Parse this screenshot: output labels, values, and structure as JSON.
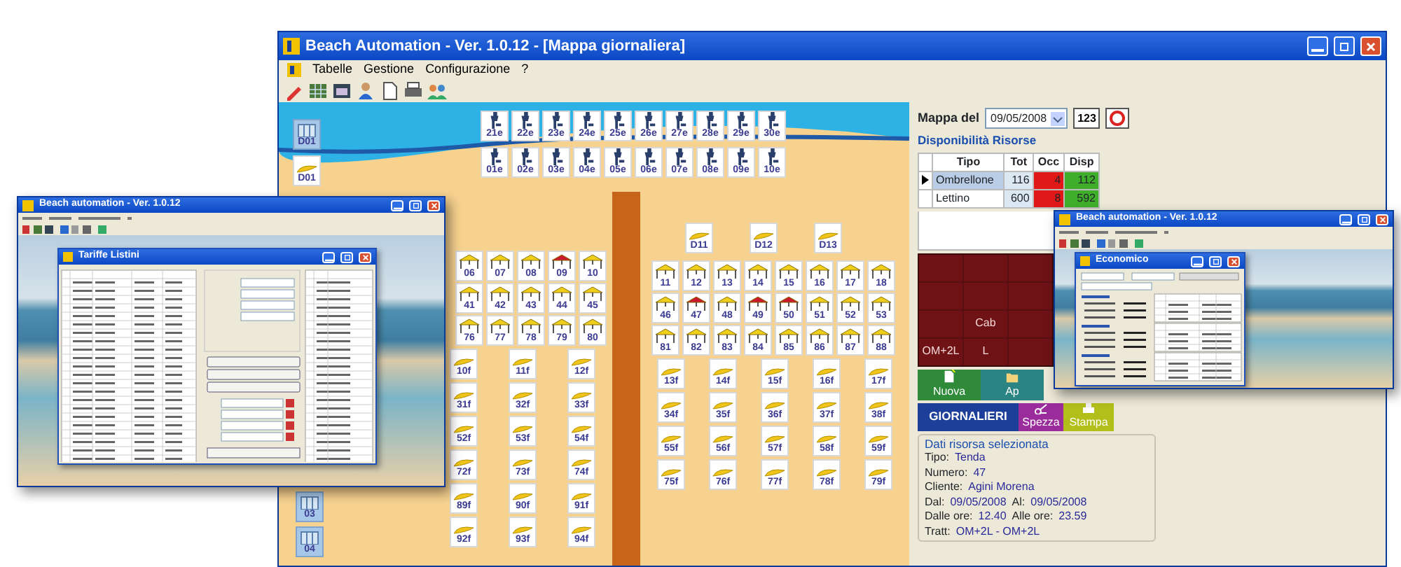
{
  "main_window": {
    "title": "Beach Automation - Ver. 1.0.12 - [Mappa giornaliera]",
    "menu": [
      "Tabelle",
      "Gestione",
      "Configurazione",
      "?"
    ]
  },
  "map": {
    "sea_cabin": "D01",
    "chair_rows": [
      [
        "21e",
        "22e",
        "23e",
        "24e",
        "25e",
        "26e",
        "27e",
        "28e",
        "29e",
        "30e"
      ],
      [
        "01e",
        "02e",
        "03e",
        "04e",
        "05e",
        "06e",
        "07e",
        "08e",
        "09e",
        "10e"
      ]
    ],
    "side_items": [
      {
        "label": "D01",
        "kind": "umbrella"
      },
      {
        "label": "03",
        "kind": "cabin"
      },
      {
        "label": "04",
        "kind": "cabin"
      }
    ],
    "left_tent_rows": [
      [
        {
          "label": "06",
          "occupied": false
        },
        {
          "label": "07",
          "occupied": false
        },
        {
          "label": "08",
          "occupied": false
        },
        {
          "label": "09",
          "occupied": true
        },
        {
          "label": "10",
          "occupied": false
        }
      ],
      [
        {
          "label": "41",
          "occupied": false
        },
        {
          "label": "42",
          "occupied": false
        },
        {
          "label": "43",
          "occupied": false
        },
        {
          "label": "44",
          "occupied": false
        },
        {
          "label": "45",
          "occupied": false
        }
      ],
      [
        {
          "label": "76",
          "occupied": false
        },
        {
          "label": "77",
          "occupied": false
        },
        {
          "label": "78",
          "occupied": false
        },
        {
          "label": "79",
          "occupied": false
        },
        {
          "label": "80",
          "occupied": false
        }
      ]
    ],
    "left_umbrella_rows": [
      [
        "10f",
        "11f",
        "12f"
      ],
      [
        "31f",
        "32f",
        "33f"
      ],
      [
        "52f",
        "53f",
        "54f"
      ],
      [
        "72f",
        "73f",
        "74f"
      ],
      [
        "89f",
        "90f",
        "91f"
      ],
      [
        "92f",
        "93f",
        "94f"
      ]
    ],
    "right_cabana_row": [
      "D11",
      "D12",
      "D13"
    ],
    "right_tent_rows": [
      [
        {
          "label": "11",
          "occupied": false
        },
        {
          "label": "12",
          "occupied": false
        },
        {
          "label": "13",
          "occupied": false
        },
        {
          "label": "14",
          "occupied": false
        },
        {
          "label": "15",
          "occupied": false
        },
        {
          "label": "16",
          "occupied": false
        },
        {
          "label": "17",
          "occupied": false
        },
        {
          "label": "18",
          "occupied": false
        }
      ],
      [
        {
          "label": "46",
          "occupied": false
        },
        {
          "label": "47",
          "occupied": true
        },
        {
          "label": "48",
          "occupied": false
        },
        {
          "label": "49",
          "occupied": true
        },
        {
          "label": "50",
          "occupied": true
        },
        {
          "label": "51",
          "occupied": false
        },
        {
          "label": "52",
          "occupied": false
        },
        {
          "label": "53",
          "occupied": false
        }
      ],
      [
        {
          "label": "81",
          "occupied": false
        },
        {
          "label": "82",
          "occupied": false
        },
        {
          "label": "83",
          "occupied": false
        },
        {
          "label": "84",
          "occupied": false
        },
        {
          "label": "85",
          "occupied": false
        },
        {
          "label": "86",
          "occupied": false
        },
        {
          "label": "87",
          "occupied": false
        },
        {
          "label": "88",
          "occupied": false
        }
      ]
    ],
    "right_umbrella_rows": [
      [
        "13f",
        "14f",
        "15f",
        "16f",
        "17f"
      ],
      [
        "34f",
        "35f",
        "36f",
        "37f",
        "38f"
      ],
      [
        "55f",
        "56f",
        "57f",
        "58f",
        "59f"
      ],
      [
        "75f",
        "76f",
        "77f",
        "78f",
        "79f"
      ]
    ]
  },
  "date_filter": {
    "label": "Mappa del",
    "value": "09/05/2008",
    "button": "123"
  },
  "availability": {
    "title": "Disponibilità Risorse",
    "columns": [
      "Tipo",
      "Tot",
      "Occ",
      "Disp"
    ],
    "rows": [
      {
        "cells": [
          "Ombrellone",
          "116",
          "4",
          "112"
        ],
        "selected": true
      },
      {
        "cells": [
          "Lettino",
          "600",
          "8",
          "592"
        ],
        "selected": false
      }
    ]
  },
  "resource_buttons": [
    {
      "kind": "blank"
    },
    {
      "kind": "blank"
    },
    {
      "kind": "blank"
    },
    {
      "kind": "blank"
    },
    {
      "kind": "blank"
    },
    {
      "kind": "blank"
    },
    {
      "kind": "blank"
    },
    {
      "kind": "labeled",
      "label": "Cab"
    },
    {
      "kind": "blank"
    },
    {
      "kind": "labeled",
      "label": "OM+2L"
    },
    {
      "kind": "labeled",
      "label": "L"
    },
    {
      "kind": "blank"
    }
  ],
  "actions": [
    {
      "label": "Nuova",
      "kind": "new"
    },
    {
      "label": "Ap",
      "kind": "open"
    }
  ],
  "mode_bar": [
    {
      "label": "GIORNALIERI",
      "kind": "mode"
    },
    {
      "label": "Spezza",
      "kind": "split"
    },
    {
      "label": "Stampa",
      "kind": "print"
    }
  ],
  "selected_resource": {
    "title": "Dati risorsa selezionata",
    "lines": [
      [
        {
          "label": "Tipo:",
          "value": "Tenda"
        }
      ],
      [
        {
          "label": "Numero:",
          "value": "47"
        }
      ],
      [
        {
          "label": "Cliente:",
          "value": "Agini Morena"
        }
      ],
      [
        {
          "label": "Dal:",
          "value": "09/05/2008"
        },
        {
          "label": "Al:",
          "value": "09/05/2008"
        }
      ],
      [
        {
          "label": "Dalle ore:",
          "value": "12.40"
        },
        {
          "label": "Alle ore:",
          "value": "23.59"
        }
      ],
      [
        {
          "label": "Tratt:",
          "value": "OM+2L - OM+2L"
        }
      ]
    ]
  },
  "left_window": {
    "title": "Beach automation - Ver. 1.0.12",
    "dialog_title": "Tariffe Listini"
  },
  "right_window": {
    "title": "Beach automation - Ver. 1.0.12",
    "dialog_title": "Economico"
  }
}
